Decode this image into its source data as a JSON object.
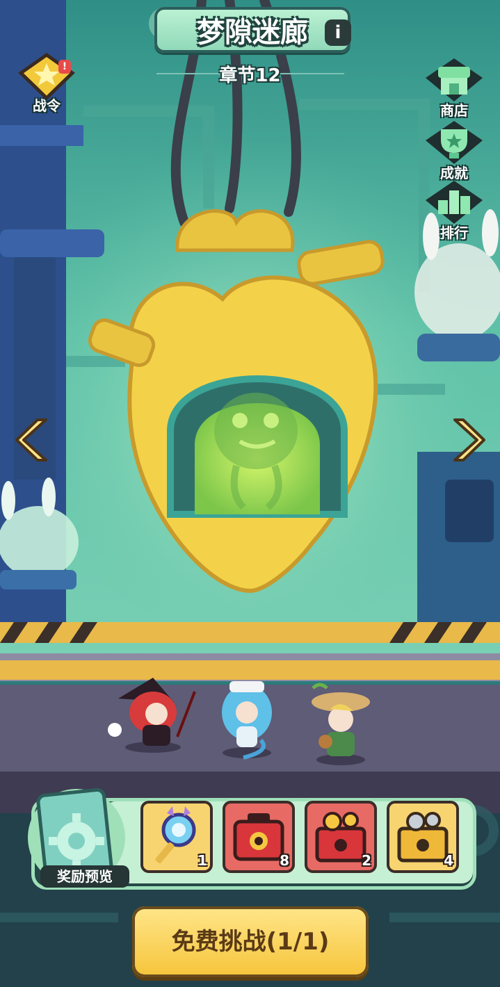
{
  "header": {
    "title": "梦隙迷廊",
    "info_icon": "info-icon",
    "info_label": "i",
    "chapter": "章节12"
  },
  "left_menu": [
    {
      "label": "战令",
      "icon": "battle-pass-star-icon",
      "badge": "!"
    }
  ],
  "right_menu": [
    {
      "label": "商店",
      "icon": "shop-icon"
    },
    {
      "label": "成就",
      "icon": "trophy-icon"
    },
    {
      "label": "排行",
      "icon": "ranking-icon"
    }
  ],
  "navigation": {
    "prev_icon": "chevron-left-icon",
    "next_icon": "chevron-right-icon"
  },
  "heroes": [
    {
      "name": "red-witch-hero"
    },
    {
      "name": "blue-sailor-hero"
    },
    {
      "name": "bard-hero"
    }
  ],
  "rewards": {
    "preview_label": "奖励预览",
    "items": [
      {
        "icon": "magic-key-icon",
        "count": "1"
      },
      {
        "icon": "red-toolbox-icon",
        "count": "8"
      },
      {
        "icon": "red-parts-box-icon",
        "count": "2"
      },
      {
        "icon": "yellow-parts-box-icon",
        "count": "4"
      }
    ]
  },
  "challenge_button": {
    "label": "免费挑战(1/1)"
  },
  "colors": {
    "accent": "#f6c43a",
    "panel": "#264848",
    "mint": "#c5f0d4"
  }
}
